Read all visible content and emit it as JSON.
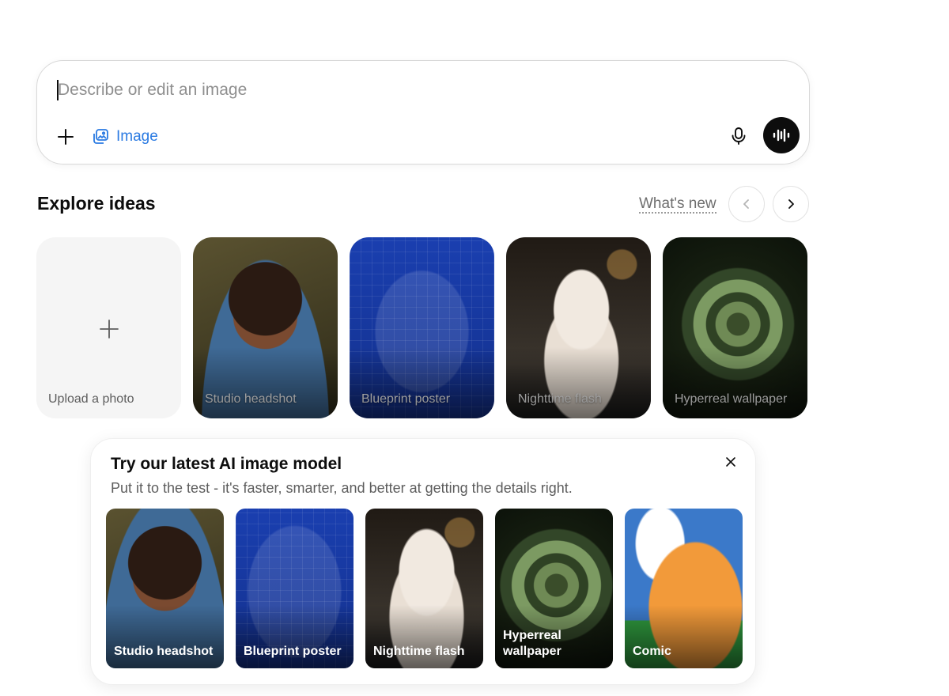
{
  "composer": {
    "placeholder": "Describe or edit an image",
    "image_label": "Image",
    "icons": [
      "plus-icon",
      "image-icon",
      "microphone-icon",
      "voice-waveform-icon"
    ]
  },
  "explore": {
    "title": "Explore ideas",
    "whats_new": "What's new",
    "cards": [
      {
        "label": "Upload a photo",
        "kind": "upload"
      },
      {
        "label": "Studio headshot",
        "kind": "portrait"
      },
      {
        "label": "Blueprint poster",
        "kind": "blueprint"
      },
      {
        "label": "Nighttime flash",
        "kind": "dog"
      },
      {
        "label": "Hyperreal wallpaper",
        "kind": "fern"
      }
    ]
  },
  "promo": {
    "title": "Try our latest AI image model",
    "subtitle": "Put it to the test - it's faster, smarter, and better at getting the details right.",
    "cards": [
      {
        "label": "Studio headshot",
        "kind": "portrait"
      },
      {
        "label": "Blueprint poster",
        "kind": "blueprint"
      },
      {
        "label": "Nighttime flash",
        "kind": "dog"
      },
      {
        "label": "Hyperreal wallpaper",
        "kind": "fern"
      },
      {
        "label": "Comic",
        "kind": "comic"
      }
    ]
  },
  "colors": {
    "accent": "#2a7ae2",
    "text": "#0d0d0d",
    "muted": "#5d5d5d",
    "border": "#d9d9d9"
  }
}
